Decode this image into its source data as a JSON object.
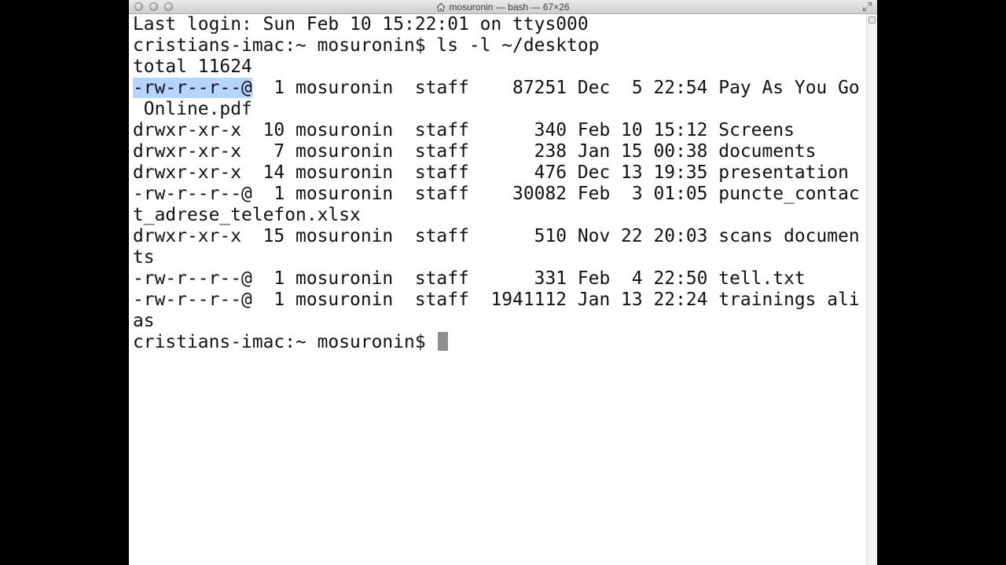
{
  "window": {
    "title": "mosuronin — bash — 67×26"
  },
  "terminal": {
    "lines": [
      {
        "pre": "Last login: Sun Feb 10 15:22:01 on ttys000"
      },
      {
        "pre": "cristians-imac:~ mosuronin$ ls -l ~/desktop"
      },
      {
        "pre": "total 11624"
      },
      {
        "selected": "-rw-r--r--@",
        "pre": "  1 mosuronin  staff    87251 Dec  5 22:54 Pay As You Go"
      },
      {
        "pre": " Online.pdf"
      },
      {
        "pre": "drwxr-xr-x  10 mosuronin  staff      340 Feb 10 15:12 Screens"
      },
      {
        "pre": "drwxr-xr-x   7 mosuronin  staff      238 Jan 15 00:38 documents"
      },
      {
        "pre": "drwxr-xr-x  14 mosuronin  staff      476 Dec 13 19:35 presentation"
      },
      {
        "pre": "-rw-r--r--@  1 mosuronin  staff    30082 Feb  3 01:05 puncte_contac"
      },
      {
        "pre": "t_adrese_telefon.xlsx"
      },
      {
        "pre": "drwxr-xr-x  15 mosuronin  staff      510 Nov 22 20:03 scans documen"
      },
      {
        "pre": "ts"
      },
      {
        "pre": "-rw-r--r--@  1 mosuronin  staff      331 Feb  4 22:50 tell.txt"
      },
      {
        "pre": "-rw-r--r--@  1 mosuronin  staff  1941112 Jan 13 22:24 trainings ali"
      },
      {
        "pre": "as"
      },
      {
        "pre": "cristians-imac:~ mosuronin$ ",
        "cursor": true
      }
    ]
  },
  "colors": {
    "selection": "#b5d5ff",
    "cursor": "#8f8f8f",
    "text": "#111111",
    "background": "#ffffff"
  },
  "icons": {
    "title_icon": "home-icon",
    "fullscreen": "fullscreen-icon"
  }
}
